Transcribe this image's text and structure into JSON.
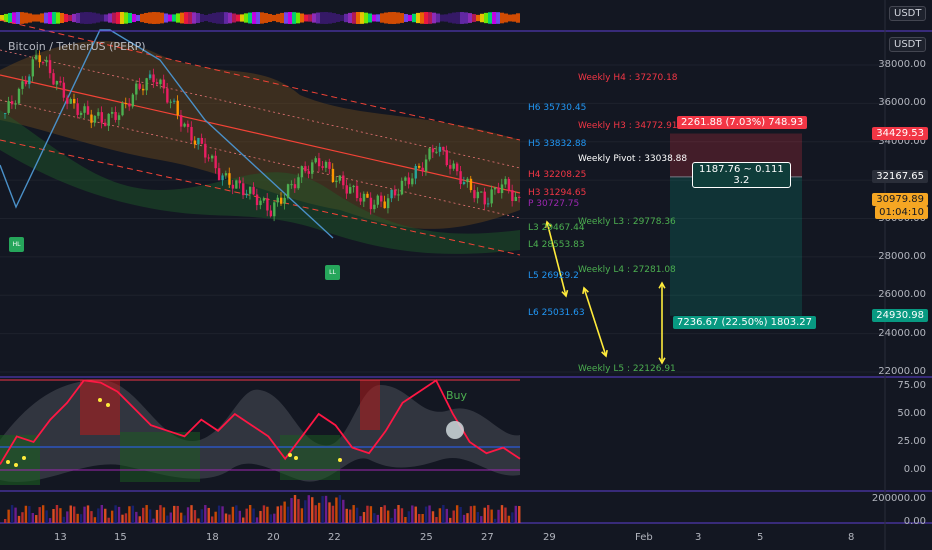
{
  "header": {
    "title": "Bitcoin / TetherUS (PERP)",
    "currency_top": "USDT",
    "currency_main": "USDT"
  },
  "price_axis": [
    "38000.00",
    "36000.00",
    "34000.00",
    "32000.00",
    "30000.00",
    "28000.00",
    "26000.00",
    "24000.00",
    "22000.00"
  ],
  "price_tags": [
    {
      "text": "34429.53",
      "bg": "#f23645",
      "price": 34429.53
    },
    {
      "text": "32167.65",
      "bg": "#2a2e39",
      "price": 32167.65
    },
    {
      "text": "30979.89",
      "bg": "#f5a623",
      "price": 30979.89,
      "fg": "#131722"
    },
    {
      "text": "01:04:10",
      "bg": "#f5a623",
      "price": 30300,
      "fg": "#131722"
    },
    {
      "text": "24930.98",
      "bg": "#089981",
      "price": 24930.98
    }
  ],
  "osc_axis": [
    "75.00",
    "50.00",
    "25.00",
    "0.00"
  ],
  "vol_axis": [
    "200000.00",
    "0.00"
  ],
  "x_axis": [
    {
      "label": "13",
      "x": 59
    },
    {
      "label": "15",
      "x": 119
    },
    {
      "label": "18",
      "x": 211
    },
    {
      "label": "20",
      "x": 272
    },
    {
      "label": "22",
      "x": 333
    },
    {
      "label": "25",
      "x": 425
    },
    {
      "label": "27",
      "x": 486
    },
    {
      "label": "29",
      "x": 548
    },
    {
      "label": "Feb",
      "x": 640
    },
    {
      "label": "3",
      "x": 700
    },
    {
      "label": "5",
      "x": 762
    },
    {
      "label": "8",
      "x": 853
    }
  ],
  "pivots_daily": [
    {
      "text": "H6 35730.45",
      "color": "#2196f3",
      "price": 35730.45
    },
    {
      "text": "H5 33832.88",
      "color": "#2196f3",
      "price": 33832.88
    },
    {
      "text": "H4 32208.25",
      "color": "#f23645",
      "price": 32208.25
    },
    {
      "text": "H3 31294.65",
      "color": "#f23645",
      "price": 31294.65
    },
    {
      "text": "P 30727.75",
      "color": "#9c27b0",
      "price": 30727.75
    },
    {
      "text": "L3 29467.44",
      "color": "#4caf50",
      "price": 29467.44
    },
    {
      "text": "L4 28553.83",
      "color": "#4caf50",
      "price": 28553.83
    },
    {
      "text": "L5 26929.2",
      "color": "#2196f3",
      "price": 26929.2
    },
    {
      "text": "L6 25031.63",
      "color": "#2196f3",
      "price": 25031.63
    }
  ],
  "pivots_weekly": [
    {
      "text": "Weekly H4 : 37270.18",
      "color": "#f23645",
      "price": 37270.18
    },
    {
      "text": "Weekly H3 : 34772.91",
      "color": "#f23645",
      "price": 34772.91
    },
    {
      "text": "Weekly Pivot : 33038.88",
      "color": "#ffffff",
      "price": 33038.88
    },
    {
      "text": "Weekly L3 : 29778.36",
      "color": "#4caf50",
      "price": 29778.36
    },
    {
      "text": "Weekly L4 : 27281.08",
      "color": "#4caf50",
      "price": 27281.08
    },
    {
      "text": "Weekly L5 : 22126.91",
      "color": "#4caf50",
      "price": 22126.91
    }
  ],
  "position_box": {
    "top_label": "2261.88 (7.03%) 748.93",
    "mid_label_1": "1187.76 ~ 0.111",
    "mid_label_2": "3.2",
    "bottom_label": "7236.67 (22.50%) 1803.27",
    "stop_price": 34429.53,
    "entry_price": 32167.65,
    "target_price": 24930.98,
    "stop_color": "#f23645",
    "target_color": "#089981"
  },
  "buy_signal": "Buy",
  "markers": [
    {
      "text": "HL"
    },
    {
      "text": "LL"
    }
  ],
  "colors": {
    "background": "#131722",
    "up": "#26a69a",
    "down": "#ef5350",
    "grid": "#2a2e39",
    "separator": "#5d3fd3"
  },
  "chart_data": {
    "type": "candlestick",
    "title": "Bitcoin / TetherUS (PERP)",
    "x_ticks": [
      "13",
      "15",
      "18",
      "20",
      "22",
      "25",
      "27",
      "29",
      "Feb",
      "3",
      "5",
      "8"
    ],
    "ylim": [
      21500,
      39500
    ],
    "y_ticks": [
      22000,
      24000,
      26000,
      28000,
      30000,
      32000,
      34000,
      36000,
      38000
    ],
    "series": [
      {
        "name": "price",
        "approx_close": [
          35500,
          36800,
          38600,
          37200,
          35900,
          35400,
          35100,
          35600,
          36800,
          37400,
          36100,
          34500,
          33600,
          32200,
          31700,
          31200,
          30400,
          31400,
          32500,
          33000,
          32000,
          31400,
          30800,
          30900,
          31800,
          32600,
          33800,
          32600,
          31600,
          30900,
          31900,
          30800
        ]
      }
    ],
    "oscillator": {
      "y_ticks": [
        0,
        25,
        50,
        75
      ],
      "approx_values": [
        5,
        30,
        25,
        45,
        60,
        80,
        78,
        70,
        55,
        40,
        35,
        30,
        45,
        35,
        50,
        40,
        30,
        10,
        30,
        50,
        40,
        20,
        15,
        35,
        60,
        70,
        80,
        50,
        25,
        15,
        20,
        10
      ]
    }
  }
}
